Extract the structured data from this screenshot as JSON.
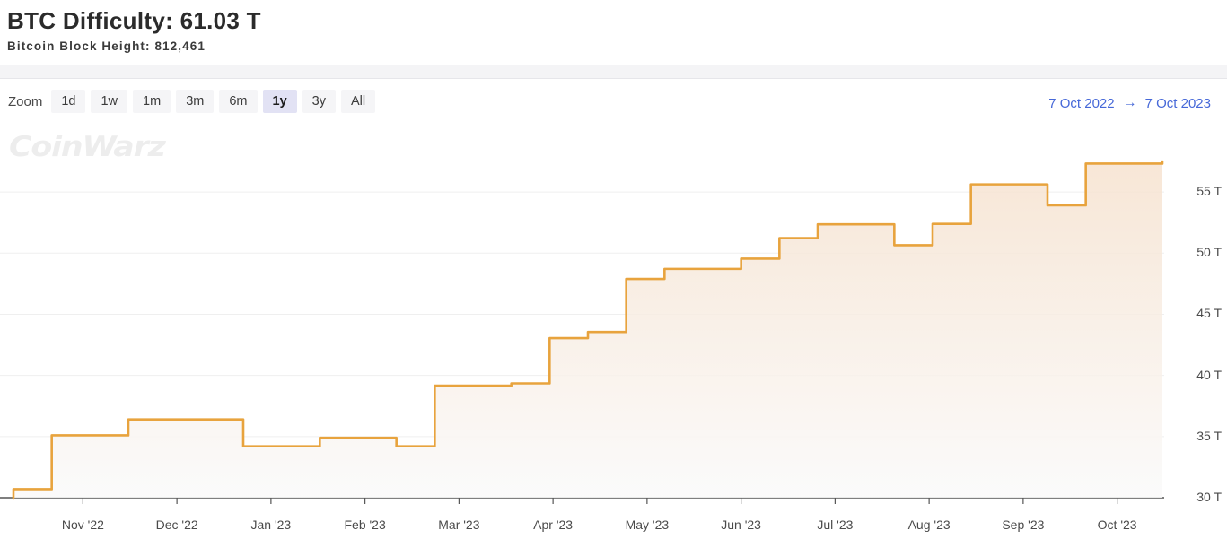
{
  "header": {
    "title": "BTC Difficulty: 61.03 T",
    "subtitle": "Bitcoin Block Height: 812,461"
  },
  "toolbar": {
    "zoom_label": "Zoom",
    "buttons": [
      {
        "label": "1d",
        "active": false
      },
      {
        "label": "1w",
        "active": false
      },
      {
        "label": "1m",
        "active": false
      },
      {
        "label": "3m",
        "active": false
      },
      {
        "label": "6m",
        "active": false
      },
      {
        "label": "1y",
        "active": true
      },
      {
        "label": "3y",
        "active": false
      },
      {
        "label": "All",
        "active": false
      }
    ],
    "range_start": "7 Oct 2022",
    "range_arrow": "→",
    "range_end": "7 Oct 2023"
  },
  "watermark": "CoinWarz",
  "colors": {
    "line": "#e8a33d",
    "fill_top": "#f6e2cf",
    "fill_bottom": "#fafafa",
    "grid": "#efefef",
    "axis": "#555555",
    "link": "#4668d8",
    "active_button_bg": "#e2e2f4"
  },
  "chart_data": {
    "type": "area",
    "title": "BTC Difficulty: 61.03 T",
    "xlabel": "",
    "ylabel": "",
    "unit": "T",
    "ylim": [
      30,
      57.5
    ],
    "yticks": [
      30,
      35,
      40,
      45,
      50,
      55
    ],
    "ytick_labels": [
      "30 T",
      "35 T",
      "40 T",
      "45 T",
      "50 T",
      "55 T"
    ],
    "grid": true,
    "legend": null,
    "xlim": [
      "7 Oct 2022",
      "7 Oct 2023"
    ],
    "xtick_labels": [
      "Nov '22",
      "Dec '22",
      "Jan '23",
      "Feb '23",
      "Mar '23",
      "Apr '23",
      "May '23",
      "Jun '23",
      "Jul '23",
      "Aug '23",
      "Sep '23",
      "Oct '23"
    ],
    "step_interpolation": true,
    "x": [
      "2022-10-07",
      "2022-10-10",
      "2022-10-23",
      "2022-11-06",
      "2022-11-20",
      "2022-12-04",
      "2022-12-14",
      "2022-12-28",
      "2023-01-08",
      "2023-01-15",
      "2023-01-22",
      "2023-02-05",
      "2023-02-19",
      "2023-03-05",
      "2023-03-19",
      "2023-04-01",
      "2023-04-15",
      "2023-04-28",
      "2023-05-12",
      "2023-05-26",
      "2023-06-08",
      "2023-06-22",
      "2023-07-06",
      "2023-07-20",
      "2023-08-01",
      "2023-08-13",
      "2023-08-27",
      "2023-09-10",
      "2023-09-20",
      "2023-10-01",
      "2023-10-07"
    ],
    "values": [
      30.7,
      35.1,
      35.1,
      36.4,
      36.4,
      36.4,
      34.2,
      34.2,
      34.9,
      34.9,
      34.2,
      39.16,
      39.16,
      39.35,
      43.05,
      43.55,
      47.89,
      48.71,
      48.71,
      49.55,
      51.23,
      52.35,
      52.35,
      50.65,
      52.39,
      55.62,
      55.62,
      53.91,
      57.32,
      57.32,
      57.5
    ],
    "series": [
      {
        "name": "BTC Difficulty",
        "values": [
          30.7,
          35.1,
          35.1,
          36.4,
          36.4,
          36.4,
          34.2,
          34.2,
          34.9,
          34.9,
          34.2,
          39.16,
          39.16,
          39.35,
          43.05,
          43.55,
          47.89,
          48.71,
          48.71,
          49.55,
          51.23,
          52.35,
          52.35,
          50.65,
          52.39,
          55.62,
          55.62,
          53.91,
          57.32,
          57.32,
          57.5
        ]
      }
    ]
  }
}
